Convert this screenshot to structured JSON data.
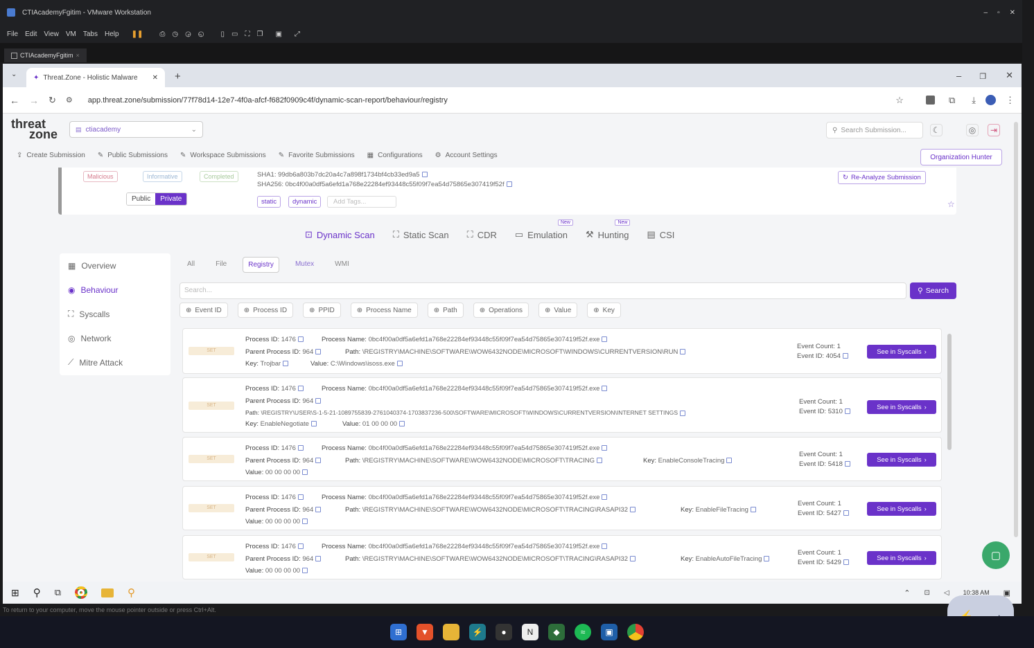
{
  "vm": {
    "window_title": "CTIAcademyFgitim - VMware Workstation",
    "menu": [
      "File",
      "Edit",
      "View",
      "VM",
      "Tabs",
      "Help"
    ],
    "tab": "CTIAcademyFgitim"
  },
  "browser": {
    "tab_title": "Threat.Zone - Holistic Malware",
    "url": "app.threat.zone/submission/77f78d14-12e7-4f0a-afcf-f682f0909c4f/dynamic-scan-report/behaviour/registry"
  },
  "app": {
    "logo_top": "threat",
    "logo_bottom": "zone",
    "workspace": "ctiacademy",
    "search_placeholder": "Search Submission...",
    "nav": [
      "Create Submission",
      "Public Submissions",
      "Workspace Submissions",
      "Favorite Submissions",
      "Configurations",
      "Account Settings"
    ],
    "org_button": "Organization Hunter"
  },
  "summary": {
    "tags": [
      "Malicious",
      "Informative",
      "Completed"
    ],
    "visibility": {
      "public": "Public",
      "private": "Private"
    },
    "sha1": "SHA1: 99db6a803b7dc20a4c7a898f1734bf4cb33ed9a5",
    "sha256": "SHA256: 0bc4f00a0df5a6efd1a768e22284ef93448c55f09f7ea54d75865e307419f52f",
    "chips": [
      "static",
      "dynamic"
    ],
    "add_tags": "Add Tags...",
    "reanalyze": "Re-Analyze Submission"
  },
  "scan_tabs": [
    {
      "label": "Dynamic Scan",
      "badge": ""
    },
    {
      "label": "Static Scan",
      "badge": ""
    },
    {
      "label": "CDR",
      "badge": ""
    },
    {
      "label": "Emulation",
      "badge": "New"
    },
    {
      "label": "Hunting",
      "badge": "New"
    },
    {
      "label": "CSI",
      "badge": ""
    }
  ],
  "sidebar": [
    "Overview",
    "Behaviour",
    "Syscalls",
    "Network",
    "Mitre Attack"
  ],
  "subtabs": [
    "All",
    "File",
    "Registry",
    "Mutex",
    "WMI"
  ],
  "search": {
    "placeholder": "Search...",
    "button": "Search"
  },
  "filters": [
    "Event ID",
    "Process ID",
    "PPID",
    "Process Name",
    "Path",
    "Operations",
    "Value",
    "Key"
  ],
  "labels": {
    "pid": "Process ID:",
    "pname": "Process Name:",
    "ppid": "Parent Process ID:",
    "path": "Path:",
    "key": "Key:",
    "value": "Value:",
    "event_count": "Event Count:",
    "event_id": "Event ID:",
    "see": "See in Syscalls"
  },
  "events": [
    {
      "badge": "SET",
      "pid": "1476",
      "pname": "0bc4f00a0df5a6efd1a768e22284ef93448c55f09f7ea54d75865e307419f52f.exe",
      "ppid": "964",
      "path": "\\REGISTRY\\MACHINE\\SOFTWARE\\WOW6432NODE\\MICROSOFT\\WINDOWS\\CURRENTVERSION\\RUN",
      "key": "Trojbar",
      "value": "C:\\Windows\\isoss.exe",
      "count": "1",
      "eid": "4054"
    },
    {
      "badge": "SET",
      "pid": "1476",
      "pname": "0bc4f00a0df5a6efd1a768e22284ef93448c55f09f7ea54d75865e307419f52f.exe",
      "ppid": "964",
      "path": "\\REGISTRY\\USER\\S-1-5-21-1089755839-2761040374-1703837236-500\\SOFTWARE\\MICROSOFT\\WINDOWS\\CURRENTVERSION\\INTERNET SETTINGS",
      "key": "EnableNegotiate",
      "value": "01 00 00 00",
      "count": "1",
      "eid": "5310"
    },
    {
      "badge": "SET",
      "pid": "1476",
      "pname": "0bc4f00a0df5a6efd1a768e22284ef93448c55f09f7ea54d75865e307419f52f.exe",
      "ppid": "964",
      "path": "\\REGISTRY\\MACHINE\\SOFTWARE\\WOW6432NODE\\MICROSOFT\\TRACING",
      "key": "EnableConsoleTracing",
      "value": "00 00 00 00",
      "count": "1",
      "eid": "5418"
    },
    {
      "badge": "SET",
      "pid": "1476",
      "pname": "0bc4f00a0df5a6efd1a768e22284ef93448c55f09f7ea54d75865e307419f52f.exe",
      "ppid": "964",
      "path": "\\REGISTRY\\MACHINE\\SOFTWARE\\WOW6432NODE\\MICROSOFT\\TRACING\\RASAPI32",
      "key": "EnableFileTracing",
      "value": "00 00 00 00",
      "count": "1",
      "eid": "5427"
    },
    {
      "badge": "SET",
      "pid": "1476",
      "pname": "0bc4f00a0df5a6efd1a768e22284ef93448c55f09f7ea54d75865e307419f52f.exe",
      "ppid": "964",
      "path": "\\REGISTRY\\MACHINE\\SOFTWARE\\WOW6432NODE\\MICROSOFT\\TRACING\\RASAPI32",
      "key": "EnableAutoFileTracing",
      "value": "00 00 00 00",
      "count": "1",
      "eid": "5429"
    }
  ],
  "vm_taskbar": {
    "time": "10:38 AM"
  },
  "hint": "To return to your computer, move the mouse pointer outside or press Ctrl+Alt.",
  "colors": {
    "accent": "#6a32c9",
    "page_bg": "#f4f5f7"
  }
}
